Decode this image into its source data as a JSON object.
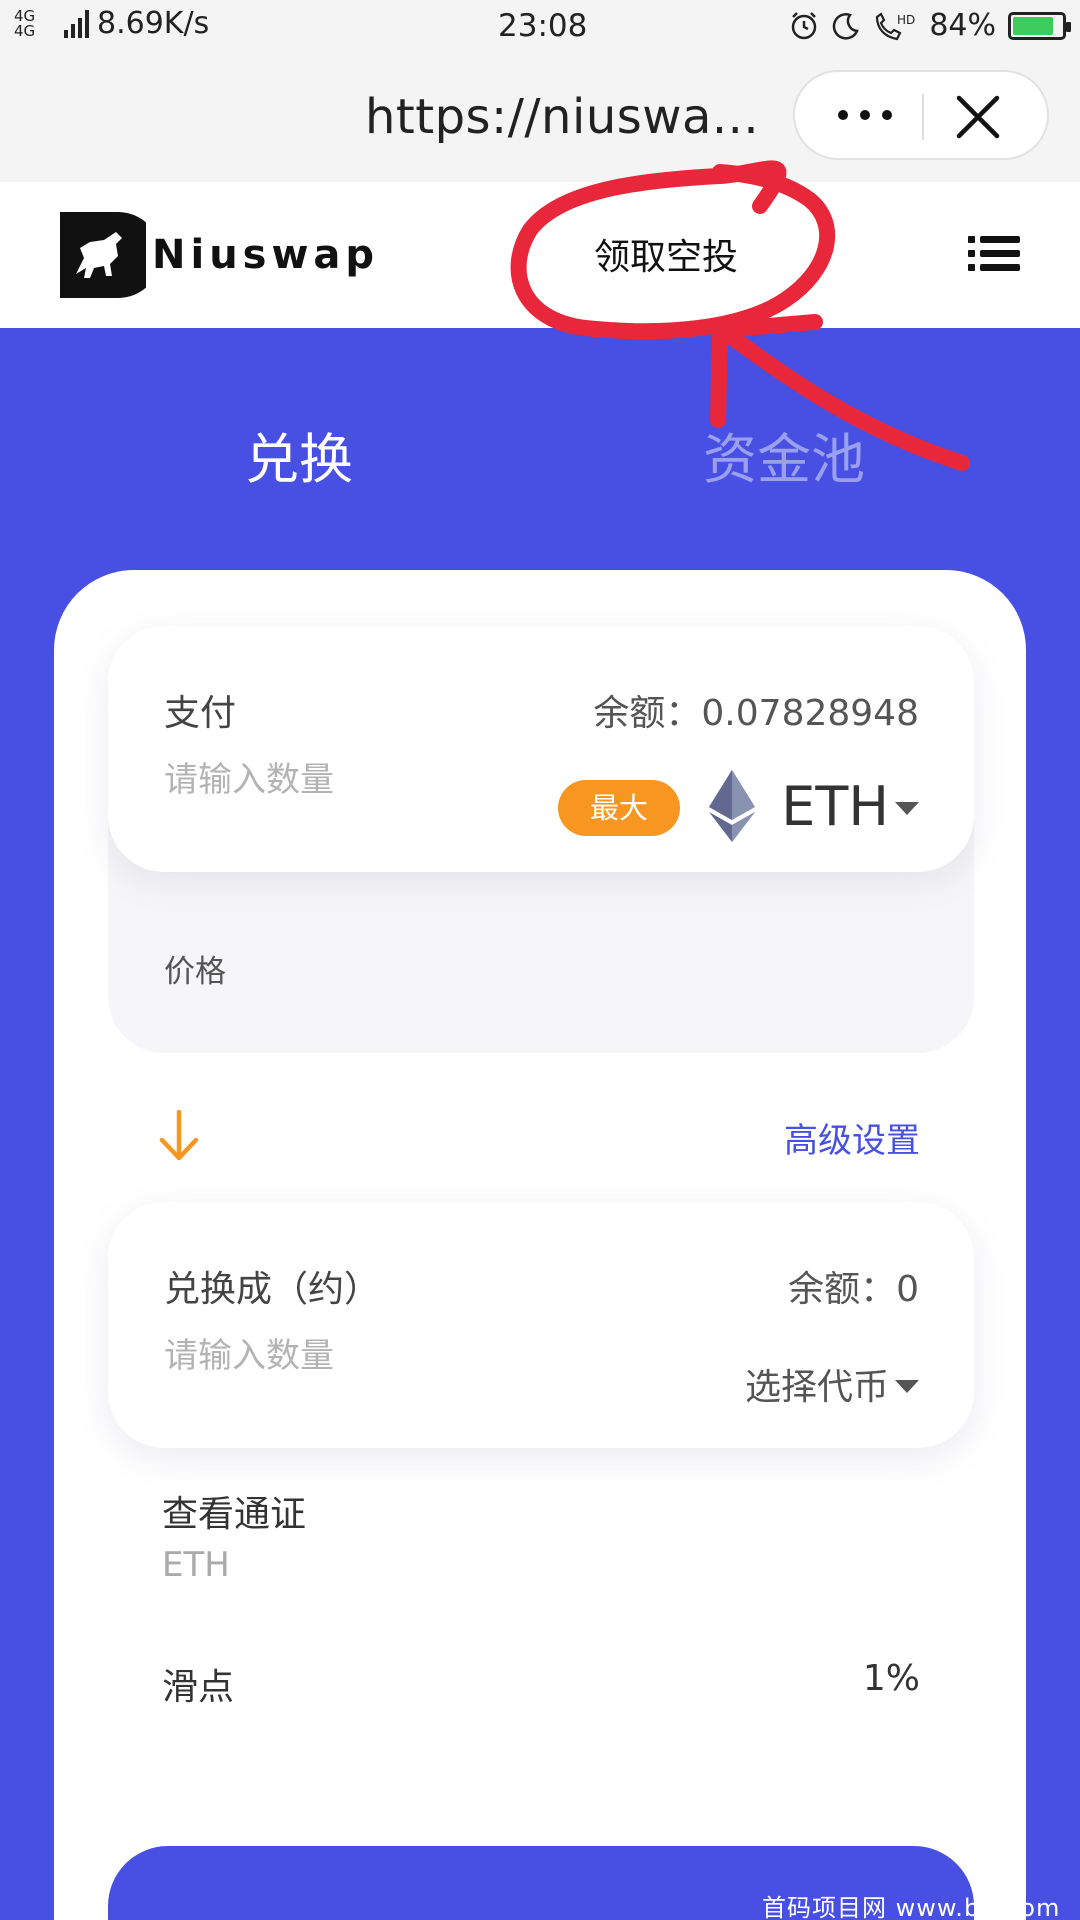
{
  "status_bar": {
    "network": "4G 4G",
    "speed": "8.69K/s",
    "time": "23:08",
    "battery": "84%",
    "icons": [
      "alarm-icon",
      "moon-icon",
      "hd-call-icon",
      "battery-icon"
    ]
  },
  "browser": {
    "url": "https://niuswa...",
    "more_icon": "more-dots-icon",
    "close_icon": "close-icon"
  },
  "header": {
    "brand": "Niuswap",
    "airdrop_link": "领取空投",
    "menu_icon": "menu-list-icon"
  },
  "tabs": [
    {
      "label": "兑换",
      "active": true
    },
    {
      "label": "资金池",
      "active": false
    }
  ],
  "pay": {
    "label": "支付",
    "balance": "余额：0.07828948",
    "placeholder": "请输入数量",
    "max_label": "最大",
    "token": "ETH"
  },
  "price": {
    "label": "价格"
  },
  "advanced_label": "高级设置",
  "receive": {
    "label": "兑换成（约）",
    "balance": "余额：0",
    "placeholder": "请输入数量",
    "select_token": "选择代币"
  },
  "view_token": {
    "label": "查看通证",
    "value": "ETH"
  },
  "slippage": {
    "label": "滑点",
    "value": "1%"
  },
  "watermark": "首码项目网 www.b...com",
  "colors": {
    "primary": "#4750e3",
    "accent_orange": "#f79722",
    "annotation_red": "#e8283a"
  }
}
